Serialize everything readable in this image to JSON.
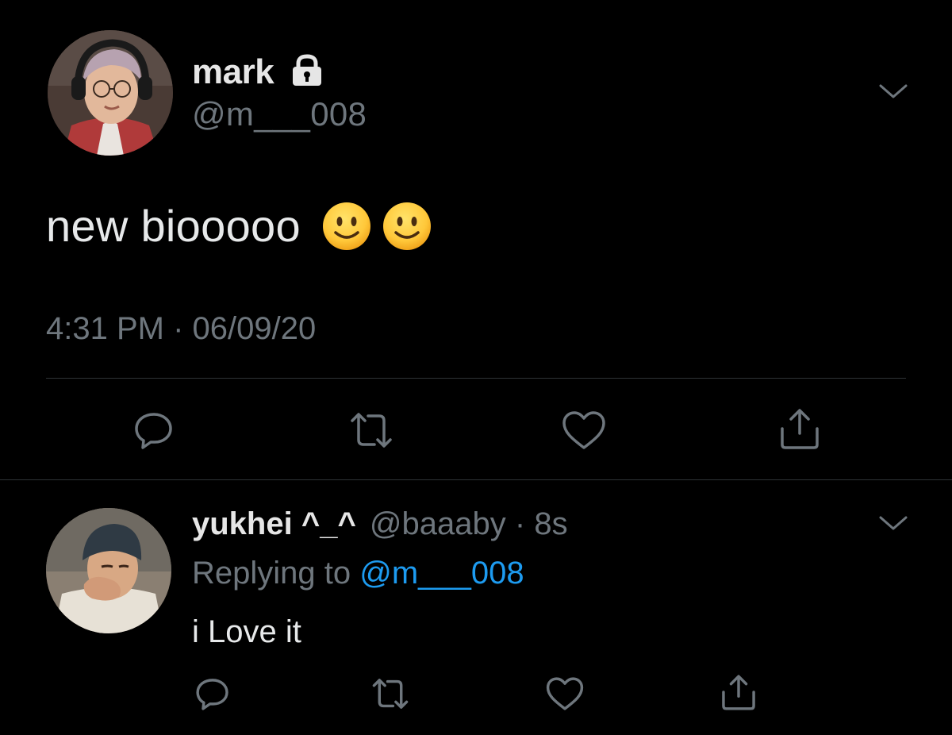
{
  "tweet": {
    "author_name": "mark",
    "author_handle": "@m___008",
    "text": "new biooooo",
    "emoji": [
      "slightly-smiling-face",
      "slightly-smiling-face"
    ],
    "timestamp": "4:31 PM · 06/09/20",
    "protected": true
  },
  "reply": {
    "author_name": "yukhei ^_^",
    "author_handle": "@baaaby",
    "separator": "·",
    "time_ago": "8s",
    "replying_prefix": "Replying to",
    "replying_to": "@m___008",
    "text": "i Love it"
  },
  "icons": {
    "lock": "lock-icon",
    "more": "chevron-down-icon",
    "reply": "reply-icon",
    "retweet": "retweet-icon",
    "like": "heart-icon",
    "share": "share-icon"
  },
  "colors": {
    "background": "#000000",
    "primary_text": "#e7e9ea",
    "secondary_text": "#6e767d",
    "link": "#1d9bf0",
    "divider": "#2f3336",
    "icon": "#6e767d"
  }
}
